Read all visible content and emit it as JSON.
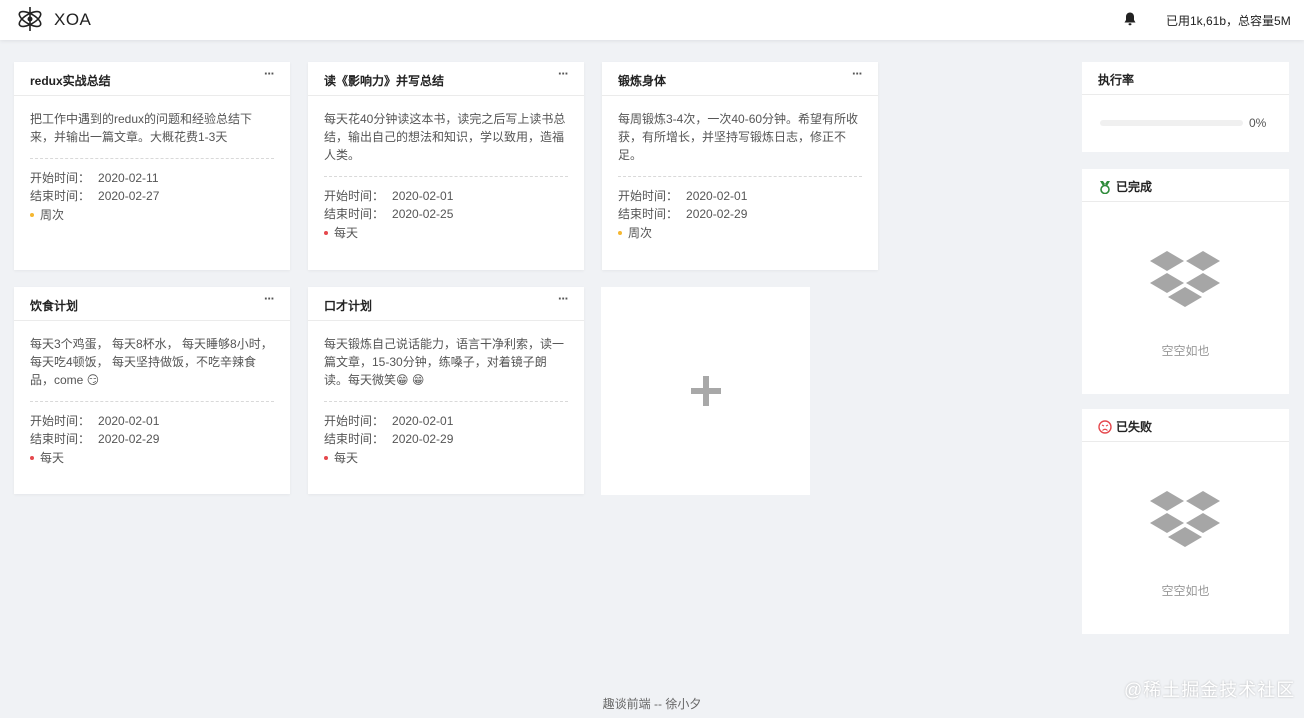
{
  "header": {
    "app_title": "XOA",
    "storage_text": "已用1k,61b，总容量5M"
  },
  "labels": {
    "start": "开始时间：",
    "end": "结束时间：",
    "more": "···"
  },
  "cards": [
    {
      "title": "redux实战总结",
      "desc": "把工作中遇到的redux的问题和经验总结下来，并输出一篇文章。大概花费1-3天",
      "start": "2020-02-11",
      "end": "2020-02-27",
      "freq": "周次",
      "freq_color": "#f5b731"
    },
    {
      "title": "读《影响力》并写总结",
      "desc": "每天花40分钟读这本书，读完之后写上读书总结，输出自己的想法和知识，学以致用，造福人类。",
      "start": "2020-02-01",
      "end": "2020-02-25",
      "freq": "每天",
      "freq_color": "#e5484d"
    },
    {
      "title": "锻炼身体",
      "desc": "每周锻炼3-4次，一次40-60分钟。希望有所收获，有所增长，并坚持写锻炼日志，修正不足。",
      "start": "2020-02-01",
      "end": "2020-02-29",
      "freq": "周次",
      "freq_color": "#f5b731"
    },
    {
      "title": "饮食计划",
      "desc": "每天3个鸡蛋， 每天8杯水， 每天睡够8小时，每天吃4顿饭， 每天坚持做饭，不吃辛辣食品，come 😏",
      "start": "2020-02-01",
      "end": "2020-02-29",
      "freq": "每天",
      "freq_color": "#e5484d"
    },
    {
      "title": "口才计划",
      "desc": "每天锻炼自己说话能力，语言干净利索，读一篇文章，15-30分钟，练嗓子，对着镜子朗读。每天微笑😁 😁",
      "start": "2020-02-01",
      "end": "2020-02-29",
      "freq": "每天",
      "freq_color": "#e5484d"
    }
  ],
  "add_card": {
    "icon": "plus-icon"
  },
  "rate_panel": {
    "title": "执行率",
    "percent_text": "0%",
    "percent": 0
  },
  "done_panel": {
    "title": "已完成",
    "empty_text": "空空如也"
  },
  "failed_panel": {
    "title": "已失败",
    "empty_text": "空空如也"
  },
  "footer": {
    "text": "趣谈前端 -- 徐小夕"
  },
  "watermark": {
    "text": "@稀土掘金技术社区"
  },
  "colors": {
    "bg": "#f0f2f5",
    "done_icon": "#2e8b3a",
    "failed_icon": "#e5484d",
    "empty_gray": "#999999"
  }
}
